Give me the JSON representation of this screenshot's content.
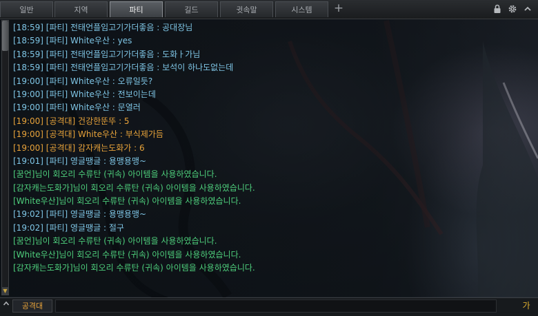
{
  "tabs": [
    {
      "label": "일반"
    },
    {
      "label": "지역"
    },
    {
      "label": "파티"
    },
    {
      "label": "길드"
    },
    {
      "label": "귓속말"
    },
    {
      "label": "시스템"
    }
  ],
  "active_tab": "파티",
  "add_tab_symbol": "+",
  "messages": [
    {
      "text": "[18:59] [파티] 전태언플임고기가더좋음 : 공대장님",
      "channel": "party"
    },
    {
      "text": "[18:59] [파티] White우산 : yes",
      "channel": "party"
    },
    {
      "text": "[18:59] [파티] 전태언플임고기가더좋음 : 도화ㅏ가님",
      "channel": "party"
    },
    {
      "text": "[18:59] [파티] 전태언플임고기가더좋음 : 보석이 하나도없는데",
      "channel": "party"
    },
    {
      "text": "[19:00] [파티] White우산 : 오류일듯?",
      "channel": "party"
    },
    {
      "text": "[19:00] [파티] White우산 : 전보이는데",
      "channel": "party"
    },
    {
      "text": "[19:00] [파티] White우산 : 문열러",
      "channel": "party"
    },
    {
      "text": "[19:00] [공격대] 건강한뚠뚜 : 5",
      "channel": "raid"
    },
    {
      "text": "[19:00] [공격대] White우산 : 부식제가듬",
      "channel": "raid"
    },
    {
      "text": "[19:00] [공격대] 감자캐는도화가 : 6",
      "channel": "raid"
    },
    {
      "text": "[19:01] [파티] 영글땡글 : 용맹용맹~",
      "channel": "party"
    },
    {
      "text": "[꿈언]님이 회오리 수류탄 (귀속) 아이템을 사용하였습니다.",
      "channel": "system"
    },
    {
      "text": "[감자캐는도화가]님이 회오리 수류탄 (귀속) 아이템을 사용하였습니다.",
      "channel": "system"
    },
    {
      "text": "[White우산]님이 회오리 수류탄 (귀속) 아이템을 사용하였습니다.",
      "channel": "system"
    },
    {
      "text": "[19:02] [파티] 영글땡글 : 용맹용맹~",
      "channel": "party"
    },
    {
      "text": "[19:02] [파티] 영글땡글 : 절구",
      "channel": "party"
    },
    {
      "text": "[꿈언]님이 회오리 수류탄 (귀속) 아이템을 사용하였습니다.",
      "channel": "system"
    },
    {
      "text": "[White우산]님이 회오리 수류탄 (귀속) 아이템을 사용하였습니다.",
      "channel": "system"
    },
    {
      "text": "[감자캐는도화가]님이 회오리 수류탄 (귀속) 아이템을 사용하였습니다.",
      "channel": "system"
    }
  ],
  "input": {
    "channel_label": "공격대",
    "ime_indicator": "가"
  },
  "icons": {
    "lock": "lock-icon",
    "settings": "gear-icon",
    "scroll_down": "triangle-down-icon",
    "expand": "chevron-up-icon"
  },
  "colors": {
    "party": "#7fc6e6",
    "raid": "#e8a33a",
    "system": "#4ecf7c"
  }
}
